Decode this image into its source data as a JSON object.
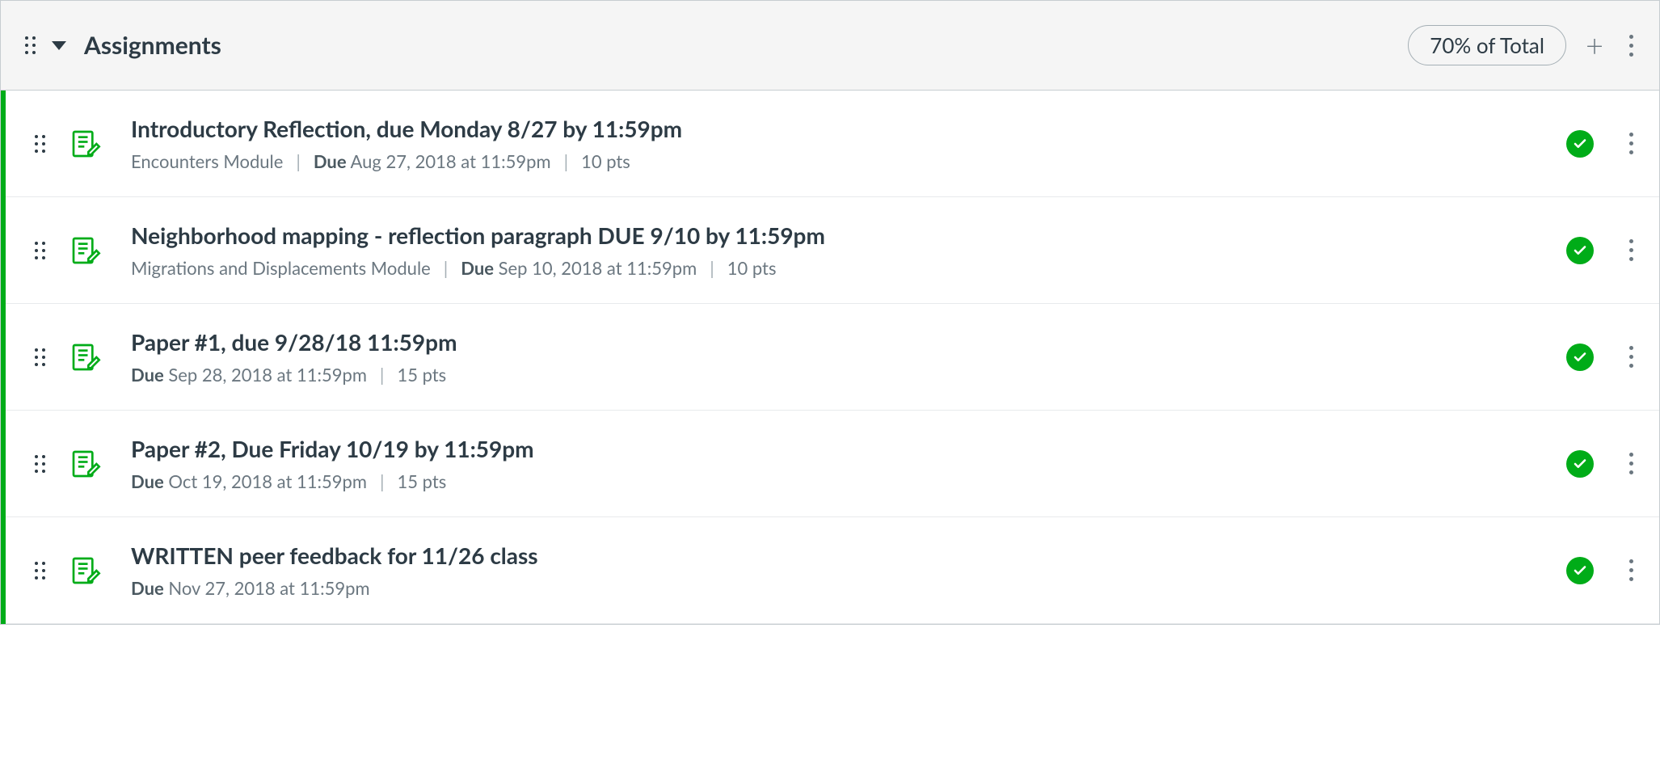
{
  "group": {
    "title": "Assignments",
    "weight_label": "70% of Total"
  },
  "assignments": [
    {
      "title": "Introductory Reflection, due Monday 8/27 by 11:59pm",
      "module": "Encounters Module",
      "due_label": "Due",
      "due_value": "Aug 27, 2018 at 11:59pm",
      "points": "10 pts"
    },
    {
      "title": "Neighborhood mapping - reflection paragraph DUE 9/10 by 11:59pm",
      "module": "Migrations and Displacements Module",
      "due_label": "Due",
      "due_value": "Sep 10, 2018 at 11:59pm",
      "points": "10 pts"
    },
    {
      "title": "Paper #1, due 9/28/18 11:59pm",
      "module": "",
      "due_label": "Due",
      "due_value": "Sep 28, 2018 at 11:59pm",
      "points": "15 pts"
    },
    {
      "title": "Paper #2, Due Friday 10/19 by 11:59pm",
      "module": "",
      "due_label": "Due",
      "due_value": "Oct 19, 2018 at 11:59pm",
      "points": "15 pts"
    },
    {
      "title": "WRITTEN peer feedback for 11/26 class",
      "module": "",
      "due_label": "Due",
      "due_value": "Nov 27, 2018 at 11:59pm",
      "points": ""
    }
  ]
}
